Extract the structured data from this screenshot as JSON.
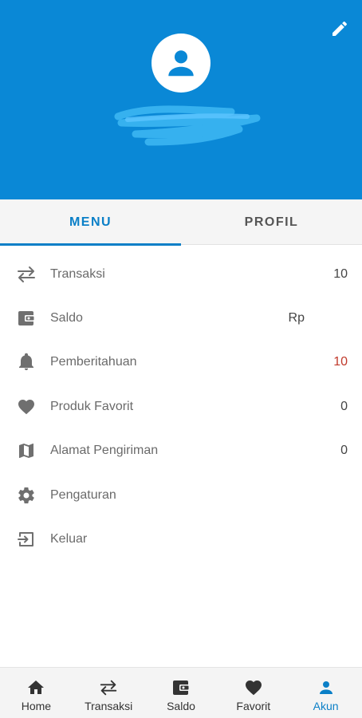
{
  "colors": {
    "primary": "#0a88d6",
    "accent": "#0a7fc7",
    "icon_gray": "#6f6f6f",
    "alert_red": "#c0392b"
  },
  "header": {
    "edit_icon": "pencil-icon",
    "avatar_icon": "person-icon",
    "user_name_redacted": true
  },
  "tabs": [
    {
      "label": "MENU",
      "active": true
    },
    {
      "label": "PROFIL",
      "active": false
    }
  ],
  "menu": {
    "items": [
      {
        "icon": "swap-arrows-icon",
        "label": "Transaksi",
        "value": "10"
      },
      {
        "icon": "wallet-icon",
        "label": "Saldo",
        "value": "Rp"
      },
      {
        "icon": "bell-icon",
        "label": "Pemberitahuan",
        "value": "10"
      },
      {
        "icon": "heart-icon",
        "label": "Produk Favorit",
        "value": "0"
      },
      {
        "icon": "map-icon",
        "label": "Alamat Pengiriman",
        "value": "0"
      },
      {
        "icon": "gear-icon",
        "label": "Pengaturan",
        "value": ""
      },
      {
        "icon": "logout-icon",
        "label": "Keluar",
        "value": ""
      }
    ]
  },
  "bottom_nav": [
    {
      "icon": "home-icon",
      "label": "Home",
      "active": false
    },
    {
      "icon": "swap-arrows-icon",
      "label": "Transaksi",
      "active": false
    },
    {
      "icon": "wallet-icon",
      "label": "Saldo",
      "active": false
    },
    {
      "icon": "heart-icon",
      "label": "Favorit",
      "active": false
    },
    {
      "icon": "person-icon",
      "label": "Akun",
      "active": true
    }
  ]
}
